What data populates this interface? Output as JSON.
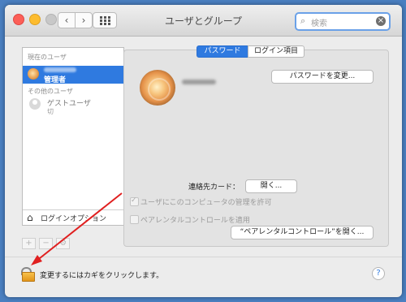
{
  "window": {
    "title": "ユーザとグループ"
  },
  "toolbar": {
    "back_icon": "‹",
    "forward_icon": "›"
  },
  "search": {
    "placeholder": "検索",
    "icon": "⌕",
    "clear_icon": "×"
  },
  "sidebar": {
    "current_header": "現在のユーザ",
    "current_user": {
      "role": "管理者"
    },
    "other_header": "その他のユーザ",
    "guest": {
      "name": "ゲストユーザ",
      "status": "切"
    },
    "login_options": "ログインオプション",
    "buttons": {
      "add": "+",
      "remove": "−",
      "gear": "⚙"
    }
  },
  "tabs": [
    {
      "label": "パスワード",
      "selected": true
    },
    {
      "label": "ログイン項目",
      "selected": false
    }
  ],
  "main": {
    "change_password_button": "パスワードを変更...",
    "contact_card_label": "連絡先カード：",
    "open_button": "開く...",
    "allow_admin": "ユーザにこのコンピュータの管理を許可",
    "parental_controls": "ペアレンタルコントロールを適用",
    "open_parental_button": "“ペアレンタルコントロール”を開く..."
  },
  "footer": {
    "lock_message": "変更するにはカギをクリックします。",
    "help": "?"
  },
  "colors": {
    "accent": "#2f7ae0",
    "annotation_arrow": "#e02020"
  }
}
